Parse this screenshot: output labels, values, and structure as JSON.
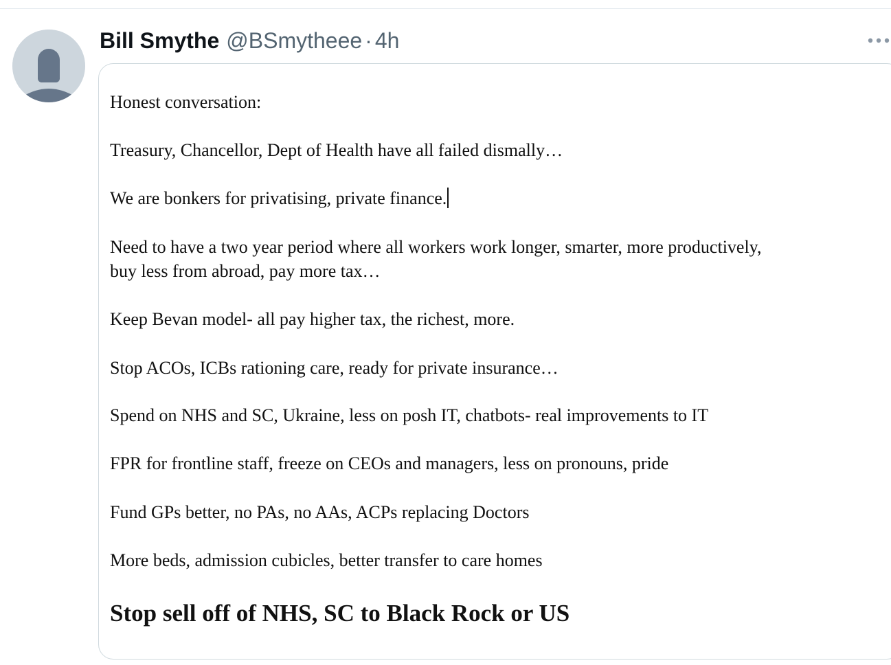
{
  "tweet": {
    "author": {
      "display_name": "Bill Smythe",
      "handle": "@BSmytheee",
      "avatar_icon": "default-avatar-icon"
    },
    "separator": "·",
    "time": "4h",
    "more_icon": "more-icon"
  },
  "image": {
    "lines": [
      "Honest conversation:",
      "Treasury, Chancellor, Dept of Health have all failed dismally…",
      "We are bonkers for privatising, private finance.",
      "Need to have a two year period where all workers work longer, smarter, more productively,",
      "buy less from abroad, pay more tax…",
      "Keep Bevan model- all pay higher tax, the richest, more.",
      "Stop ACOs, ICBs rationing care, ready for private insurance…",
      "Spend on NHS and SC, Ukraine, less on posh IT, chatbots- real improvements to IT",
      "FPR for frontline staff, freeze on CEOs and managers, less on pronouns, pride",
      "Fund GPs better, no PAs, no AAs, ACPs replacing Doctors",
      "More beds, admission cubicles, better transfer to care homes"
    ],
    "headline": "Stop sell off of NHS, SC to Black Rock or US"
  }
}
